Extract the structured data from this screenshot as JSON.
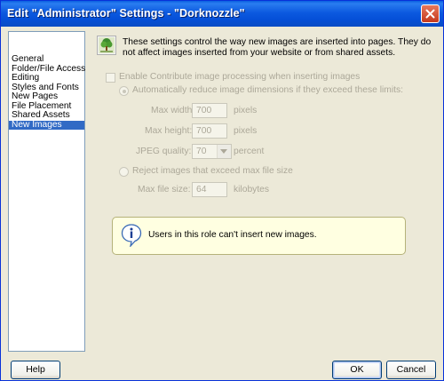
{
  "window": {
    "title": "Edit \"Administrator\" Settings - \"Dorknozzle\""
  },
  "nav": {
    "items": [
      {
        "label": "General"
      },
      {
        "label": "Folder/File Access"
      },
      {
        "label": "Editing"
      },
      {
        "label": "Styles and Fonts"
      },
      {
        "label": "New Pages"
      },
      {
        "label": "File Placement"
      },
      {
        "label": "Shared Assets"
      },
      {
        "label": "New Images"
      }
    ],
    "selected": "New Images"
  },
  "content": {
    "intro": "These settings control the way new images are inserted into pages. They do not affect images inserted from your website or from shared assets.",
    "enable_label": "Enable Contribute image processing when inserting images",
    "reduce_label": "Automatically reduce image dimensions if they exceed these limits:",
    "max_width_label": "Max width:",
    "max_width_value": "700",
    "max_width_unit": "pixels",
    "max_height_label": "Max height:",
    "max_height_value": "700",
    "max_height_unit": "pixels",
    "jpeg_label": "JPEG quality:",
    "jpeg_value": "70",
    "jpeg_unit": "percent",
    "reject_label": "Reject images that exceed max file size",
    "max_file_label": "Max file size:",
    "max_file_value": "64",
    "max_file_unit": "kilobytes",
    "alert_message": "Users in this role can't insert new images."
  },
  "buttons": {
    "help": "Help",
    "ok": "OK",
    "cancel": "Cancel"
  },
  "colors": {
    "titlebar": "#0550d8",
    "selection": "#316ac5",
    "alert_bg": "#ffffe1",
    "dialog_bg": "#ece9d8"
  }
}
